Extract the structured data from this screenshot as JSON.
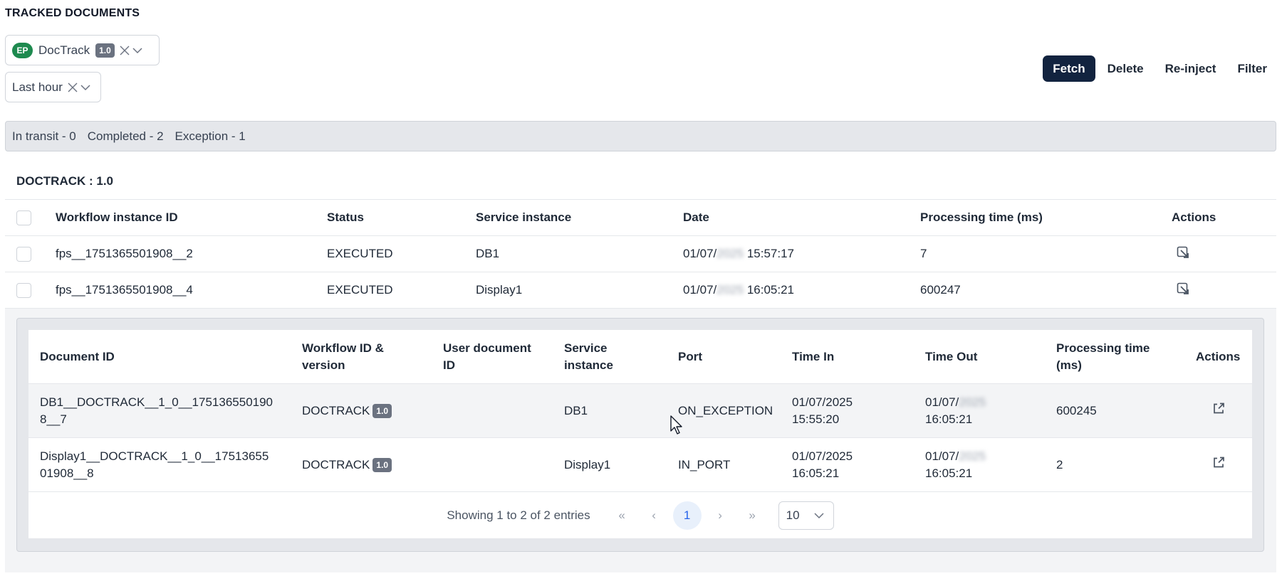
{
  "page": {
    "heading": "TRACKED DOCUMENTS"
  },
  "filters": {
    "workflow": {
      "badge": "EP",
      "label": "DocTrack",
      "version": "1.0"
    },
    "time_range": {
      "label": "Last hour"
    }
  },
  "toolbar": {
    "fetch": "Fetch",
    "delete": "Delete",
    "reinject": "Re-inject",
    "filter": "Filter"
  },
  "summary": {
    "in_transit": "In transit - 0",
    "completed": "Completed - 2",
    "exception": "Exception - 1"
  },
  "section": {
    "title": "DOCTRACK : 1.0"
  },
  "outer_table": {
    "headers": [
      "Workflow instance ID",
      "Status",
      "Service instance",
      "Date",
      "Processing time (ms)",
      "Actions"
    ],
    "rows": [
      {
        "id": "fps__1751365501908__2",
        "status": "EXECUTED",
        "service": "DB1",
        "date_prefix": "01/07/",
        "date_year": "2025",
        "date_time": "15:57:17",
        "processing": "7"
      },
      {
        "id": "fps__1751365501908__4",
        "status": "EXECUTED",
        "service": "Display1",
        "date_prefix": "01/07/",
        "date_year": "2025",
        "date_time": "16:05:21",
        "processing": "600247"
      }
    ]
  },
  "detail_table": {
    "headers": [
      "Document ID",
      "Workflow ID & version",
      "User document ID",
      "Service instance",
      "Port",
      "Time In",
      "Time Out",
      "Processing time (ms)",
      "Actions"
    ],
    "rows": [
      {
        "doc_id": "DB1__DOCTRACK__1_0__1751365501908__7",
        "workflow": "DOCTRACK",
        "version": "1.0",
        "user_doc": "",
        "service": "DB1",
        "port": "ON_EXCEPTION",
        "time_in_date": "01/07/2025",
        "time_in_time": "15:55:20",
        "time_out_prefix": "01/07/",
        "time_out_year": "2025",
        "time_out_time": "16:05:21",
        "processing": "600245"
      },
      {
        "doc_id": "Display1__DOCTRACK__1_0__1751365501908__8",
        "workflow": "DOCTRACK",
        "version": "1.0",
        "user_doc": "",
        "service": "Display1",
        "port": "IN_PORT",
        "time_in_date": "01/07/2025",
        "time_in_time": "16:05:21",
        "time_out_prefix": "01/07/",
        "time_out_year": "2025",
        "time_out_time": "16:05:21",
        "processing": "2"
      }
    ]
  },
  "pagination": {
    "summary": "Showing 1 to 2 of 2 entries",
    "first": "«",
    "prev": "‹",
    "current": "1",
    "next": "›",
    "last": "»",
    "per_page": "10"
  },
  "colors": {
    "primary_button": "#12233f",
    "ep_badge": "#1e8a4f",
    "version_badge": "#6b7280",
    "current_page": "#2563eb"
  }
}
